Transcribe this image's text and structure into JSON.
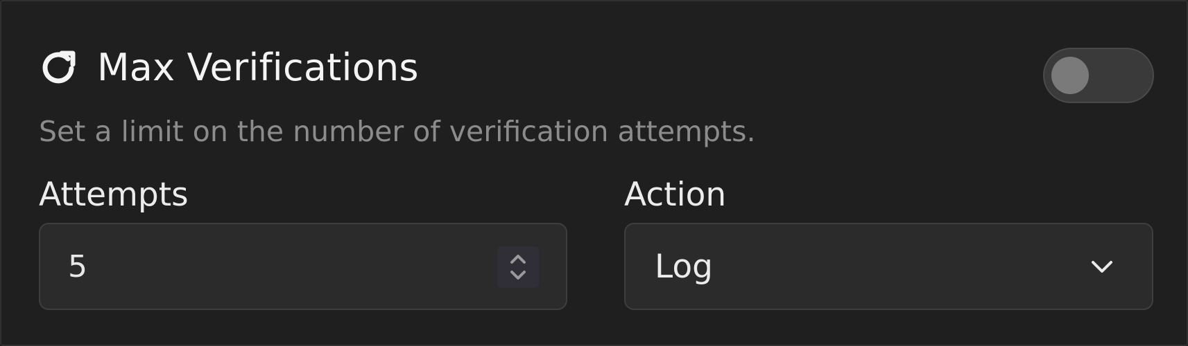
{
  "setting": {
    "title": "Max Verifications",
    "description": "Set a limit on the number of verification attempts.",
    "icon": "refresh-icon",
    "enabled": false
  },
  "attempts": {
    "label": "Attempts",
    "value": "5"
  },
  "action": {
    "label": "Action",
    "selected": "Log"
  },
  "colors": {
    "background": "#1f1f1f",
    "field_background": "#2b2b2b",
    "toggle_off": "#3a3a3a",
    "muted_text": "#8c8c8c"
  }
}
